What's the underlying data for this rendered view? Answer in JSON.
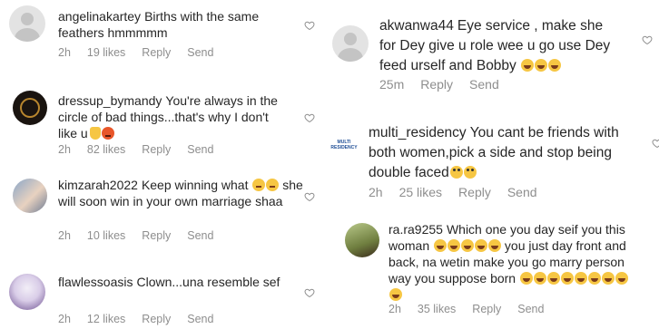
{
  "comments_left": [
    {
      "username": "angelinakartey",
      "text": "Births with the same feathers hmmmmm",
      "time": "2h",
      "likes": "19 likes",
      "reply": "Reply",
      "send": "Send"
    },
    {
      "username": "dressup_bymandy",
      "text": "You're always in the circle of bad things...that's why I don't like u",
      "time": "2h",
      "likes": "82 likes",
      "reply": "Reply",
      "send": "Send"
    },
    {
      "username": "kimzarah2022",
      "text_before": "Keep winning what",
      "text_after": "she will soon win in your own marriage shaa",
      "time": "2h",
      "likes": "10 likes",
      "reply": "Reply",
      "send": "Send"
    },
    {
      "username": "flawlessoasis",
      "text": "Clown...una resemble sef",
      "time": "2h",
      "likes": "12 likes",
      "reply": "Reply",
      "send": "Send"
    }
  ],
  "comments_right": [
    {
      "username": "akwanwa44",
      "text": "Eye service , make she for Dey give u role wee u go use Dey feed urself and Bobby",
      "time": "25m",
      "reply": "Reply",
      "send": "Send"
    },
    {
      "username": "multi_residency",
      "avatar_text": "MULTI RESIDENCY",
      "text": "You cant be friends with both women,pick a side and stop being double faced",
      "time": "2h",
      "likes": "25 likes",
      "reply": "Reply",
      "send": "Send"
    },
    {
      "username": "ra.ra9255",
      "text_before": "Which one you day seif you this woman",
      "text_after": "you just day front and back, na wetin make you go marry person way you suppose born",
      "time": "2h",
      "likes": "35 likes",
      "reply": "Reply",
      "send": "Send"
    }
  ],
  "icons": {
    "like": "heart-outline-icon",
    "default_avatar": "default-avatar-icon"
  },
  "colors": {
    "meta": "#8e8e8e",
    "text": "#262626"
  }
}
